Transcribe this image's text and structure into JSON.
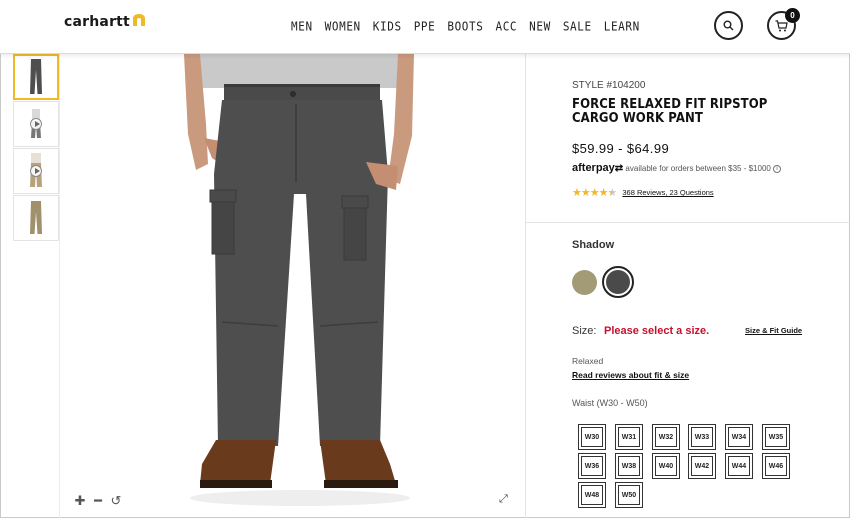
{
  "brand": {
    "name": "carhartt"
  },
  "nav": [
    "MEN",
    "WOMEN",
    "KIDS",
    "PPE",
    "BOOTS",
    "ACC",
    "NEW",
    "SALE",
    "LEARN"
  ],
  "cart": {
    "count": "0"
  },
  "product": {
    "style": "STYLE #104200",
    "title": "FORCE RELAXED FIT RIPSTOP CARGO WORK PANT",
    "price": "$59.99 - $64.99",
    "afterpay": {
      "logo": "afterpay",
      "text": "available for orders between $35 - $1000"
    },
    "rating": 4.5,
    "reviews_link": "368 Reviews, 23 Questions",
    "color_name": "Shadow",
    "colors": [
      {
        "name": "tan-swatch",
        "hex": "#a39a76"
      },
      {
        "name": "shadow-swatch",
        "hex": "#4a4a4a"
      }
    ],
    "size_label": "Size:",
    "size_error": "Please select a size.",
    "size_guide": "Size & Fit Guide",
    "fit": "Relaxed",
    "fit_link": "Read reviews about fit & size",
    "waist_label": "Waist (W30 - W50)",
    "sizes": [
      "W30",
      "W31",
      "W32",
      "W33",
      "W34",
      "W35",
      "W36",
      "W38",
      "W40",
      "W42",
      "W44",
      "W46",
      "W48",
      "W50"
    ]
  },
  "colors": {
    "accent": "#f0b929",
    "error": "#c8102e",
    "pant": "#4e4e4e"
  }
}
